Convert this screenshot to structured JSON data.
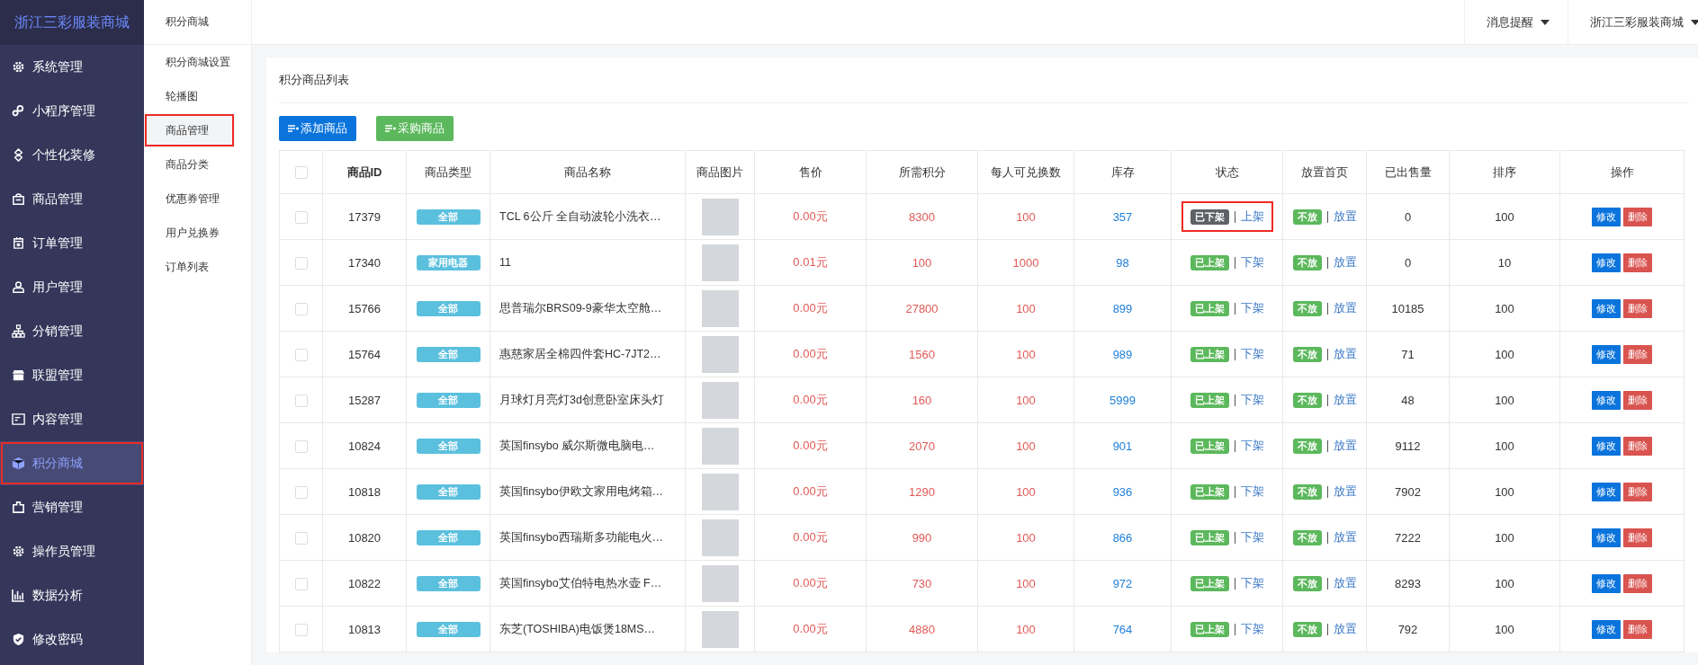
{
  "brand": "浙江三彩服装商城",
  "sidebar": {
    "items": [
      {
        "label": "系统管理",
        "selected": false,
        "highlighted": false
      },
      {
        "label": "小程序管理",
        "selected": false,
        "highlighted": false
      },
      {
        "label": "个性化装修",
        "selected": false,
        "highlighted": false
      },
      {
        "label": "商品管理",
        "selected": false,
        "highlighted": false
      },
      {
        "label": "订单管理",
        "selected": false,
        "highlighted": false
      },
      {
        "label": "用户管理",
        "selected": false,
        "highlighted": false
      },
      {
        "label": "分销管理",
        "selected": false,
        "highlighted": false
      },
      {
        "label": "联盟管理",
        "selected": false,
        "highlighted": false
      },
      {
        "label": "内容管理",
        "selected": false,
        "highlighted": false
      },
      {
        "label": "积分商城",
        "selected": true,
        "highlighted": true
      },
      {
        "label": "营销管理",
        "selected": false,
        "highlighted": false
      },
      {
        "label": "操作员管理",
        "selected": false,
        "highlighted": false
      },
      {
        "label": "数据分析",
        "selected": false,
        "highlighted": false
      },
      {
        "label": "修改密码",
        "selected": false,
        "highlighted": false
      }
    ]
  },
  "submenu": {
    "title": "积分商城",
    "items": [
      {
        "label": "积分商城设置",
        "selected": false,
        "highlighted": false
      },
      {
        "label": "轮播图",
        "selected": false,
        "highlighted": false
      },
      {
        "label": "商品管理",
        "selected": true,
        "highlighted": true
      },
      {
        "label": "商品分类",
        "selected": false,
        "highlighted": false
      },
      {
        "label": "优惠券管理",
        "selected": false,
        "highlighted": false
      },
      {
        "label": "用户兑换券",
        "selected": false,
        "highlighted": false
      },
      {
        "label": "订单列表",
        "selected": false,
        "highlighted": false
      }
    ]
  },
  "topbar": {
    "items": [
      "消息提醒",
      "浙江三彩服装商城"
    ]
  },
  "panel": {
    "title": "积分商品列表",
    "buttons": [
      {
        "label": "添加商品",
        "kind": "primary"
      },
      {
        "label": "采购商品",
        "kind": "success"
      }
    ]
  },
  "table": {
    "select_all_checked": false,
    "columns": [
      "商品ID",
      "商品类型",
      "商品名称",
      "商品图片",
      "售价",
      "所需积分",
      "每人可兑换数",
      "库存",
      "状态",
      "放置首页",
      "已出售量",
      "排序",
      "操作"
    ],
    "rows": [
      {
        "checked": false,
        "id": "17379",
        "type": "全部",
        "name": "TCL 6公斤 全自动波轮小洗衣…",
        "price": "0.00元",
        "points": "8300",
        "limit": "100",
        "stock": "357",
        "status": "已下架",
        "status_on": false,
        "status_action": "上架",
        "highlighted": true,
        "home": "不放",
        "home_action": "放置",
        "sold": "0",
        "sort": "100",
        "edit": "修改",
        "delete": "删除"
      },
      {
        "checked": false,
        "id": "17340",
        "type": "家用电器",
        "name": "11",
        "price": "0.01元",
        "points": "100",
        "limit": "1000",
        "stock": "98",
        "status": "已上架",
        "status_on": true,
        "status_action": "下架",
        "highlighted": false,
        "home": "不放",
        "home_action": "放置",
        "sold": "0",
        "sort": "10",
        "edit": "修改",
        "delete": "删除"
      },
      {
        "checked": false,
        "id": "15766",
        "type": "全部",
        "name": "思普瑞尔BRS09-9豪华太空舱…",
        "price": "0.00元",
        "points": "27800",
        "limit": "100",
        "stock": "899",
        "status": "已上架",
        "status_on": true,
        "status_action": "下架",
        "highlighted": false,
        "home": "不放",
        "home_action": "放置",
        "sold": "10185",
        "sort": "100",
        "edit": "修改",
        "delete": "删除"
      },
      {
        "checked": false,
        "id": "15764",
        "type": "全部",
        "name": "惠慈家居全棉四件套HC-7JT2…",
        "price": "0.00元",
        "points": "1560",
        "limit": "100",
        "stock": "989",
        "status": "已上架",
        "status_on": true,
        "status_action": "下架",
        "highlighted": false,
        "home": "不放",
        "home_action": "放置",
        "sold": "71",
        "sort": "100",
        "edit": "修改",
        "delete": "删除"
      },
      {
        "checked": false,
        "id": "15287",
        "type": "全部",
        "name": "月球灯月亮灯3d创意卧室床头灯",
        "price": "0.00元",
        "points": "160",
        "limit": "100",
        "stock": "5999",
        "status": "已上架",
        "status_on": true,
        "status_action": "下架",
        "highlighted": false,
        "home": "不放",
        "home_action": "放置",
        "sold": "48",
        "sort": "100",
        "edit": "修改",
        "delete": "删除"
      },
      {
        "checked": false,
        "id": "10824",
        "type": "全部",
        "name": "英国finsybo 威尔斯微电脑电…",
        "price": "0.00元",
        "points": "2070",
        "limit": "100",
        "stock": "901",
        "status": "已上架",
        "status_on": true,
        "status_action": "下架",
        "highlighted": false,
        "home": "不放",
        "home_action": "放置",
        "sold": "9112",
        "sort": "100",
        "edit": "修改",
        "delete": "删除"
      },
      {
        "checked": false,
        "id": "10818",
        "type": "全部",
        "name": "英国finsybo伊欧文家用电烤箱…",
        "price": "0.00元",
        "points": "1290",
        "limit": "100",
        "stock": "936",
        "status": "已上架",
        "status_on": true,
        "status_action": "下架",
        "highlighted": false,
        "home": "不放",
        "home_action": "放置",
        "sold": "7902",
        "sort": "100",
        "edit": "修改",
        "delete": "删除"
      },
      {
        "checked": false,
        "id": "10820",
        "type": "全部",
        "name": "英国finsybo西瑞斯多功能电火…",
        "price": "0.00元",
        "points": "990",
        "limit": "100",
        "stock": "866",
        "status": "已上架",
        "status_on": true,
        "status_action": "下架",
        "highlighted": false,
        "home": "不放",
        "home_action": "放置",
        "sold": "7222",
        "sort": "100",
        "edit": "修改",
        "delete": "删除"
      },
      {
        "checked": false,
        "id": "10822",
        "type": "全部",
        "name": "英国finsybo艾伯特电热水壶 F…",
        "price": "0.00元",
        "points": "730",
        "limit": "100",
        "stock": "972",
        "status": "已上架",
        "status_on": true,
        "status_action": "下架",
        "highlighted": false,
        "home": "不放",
        "home_action": "放置",
        "sold": "8293",
        "sort": "100",
        "edit": "修改",
        "delete": "删除"
      },
      {
        "checked": false,
        "id": "10813",
        "type": "全部",
        "name": "东芝(TOSHIBA)电饭煲18MS…",
        "price": "0.00元",
        "points": "4880",
        "limit": "100",
        "stock": "764",
        "status": "已上架",
        "status_on": true,
        "status_action": "下架",
        "highlighted": false,
        "home": "不放",
        "home_action": "放置",
        "sold": "792",
        "sort": "100",
        "edit": "修改",
        "delete": "删除"
      }
    ]
  }
}
